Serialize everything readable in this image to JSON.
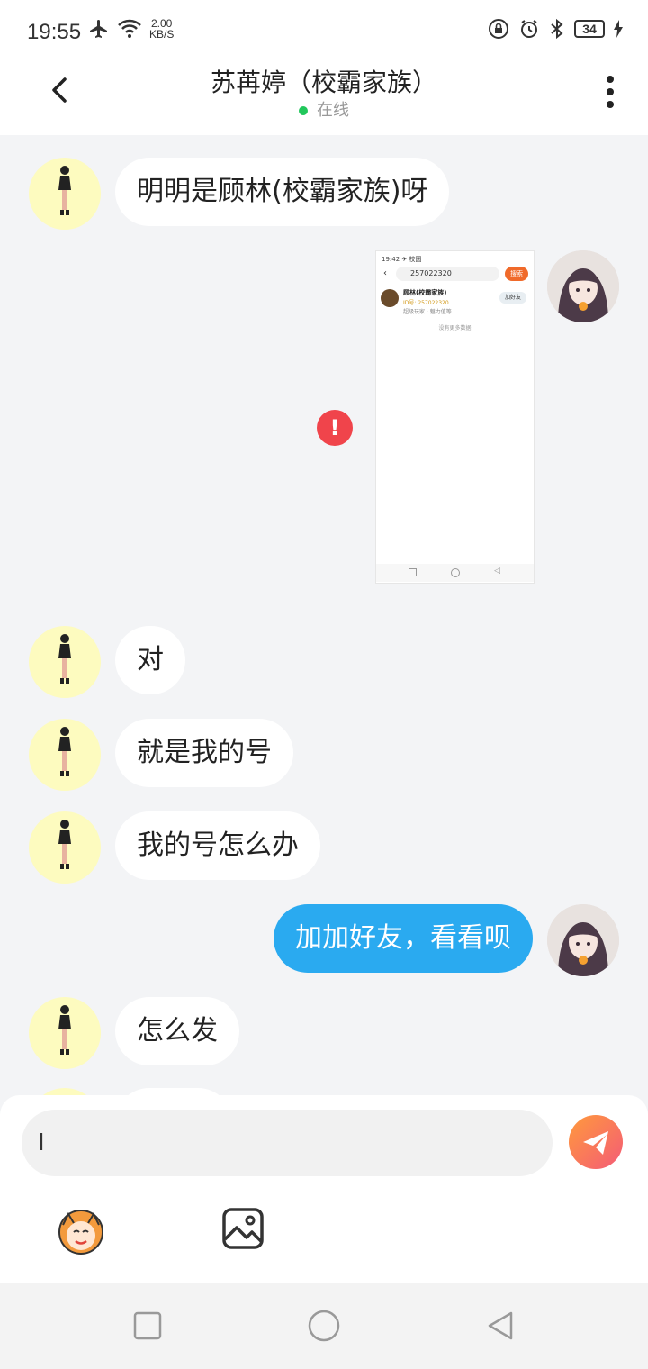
{
  "status_bar": {
    "time": "19:55",
    "net_speed_value": "2.00",
    "net_speed_unit": "KB/S",
    "battery": "34"
  },
  "header": {
    "title": "苏苒婷（校霸家族）",
    "status": "在线"
  },
  "messages": [
    {
      "side": "left",
      "text": "明明是顾林(校霸家族)呀"
    },
    {
      "side": "right",
      "type": "image",
      "failed": true
    },
    {
      "side": "left",
      "text": "对"
    },
    {
      "side": "left",
      "text": "就是我的号"
    },
    {
      "side": "left",
      "text": "我的号怎么办"
    },
    {
      "side": "right",
      "text": "加加好友，看看呗"
    },
    {
      "side": "left",
      "text": "怎么发"
    }
  ],
  "embedded_screenshot": {
    "status_time": "19:42 ✈ 校园",
    "search_text": "257022320",
    "search_button": "搜索",
    "result_name": "顾林(校霸家族)",
    "result_id": "ID号: 257022320",
    "result_sub": "超级玩家 · 魅力值等",
    "add_button": "加好友",
    "no_more": "没有更多数据"
  },
  "composer": {
    "input_value": "I",
    "placeholder": ""
  },
  "colors": {
    "accent": "#2aaaf0",
    "online": "#21c75b",
    "error": "#f0444b"
  },
  "icons": {
    "back": "back-arrow-icon",
    "more": "more-vertical-icon",
    "send": "send-icon",
    "emoji": "emoji-icon",
    "image": "image-icon"
  }
}
